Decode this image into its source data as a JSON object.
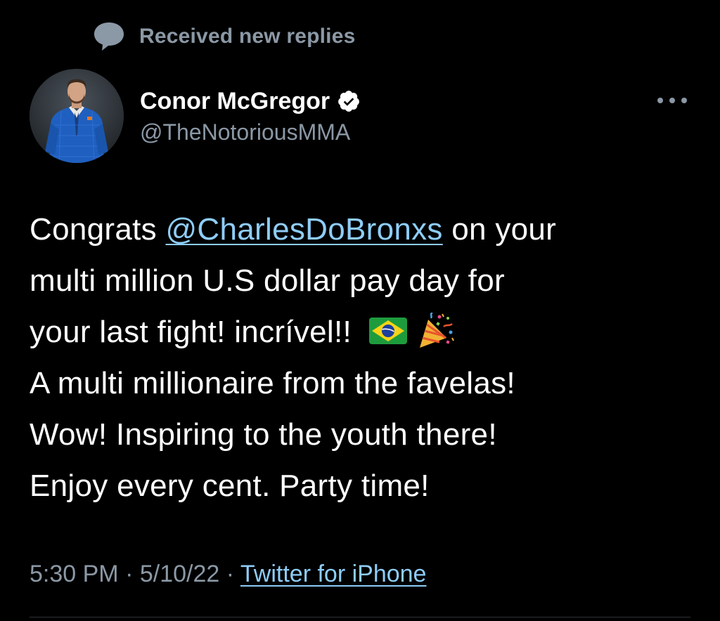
{
  "notice": {
    "text": "Received new replies",
    "icon": "speech-bubble-icon"
  },
  "author": {
    "display_name": "Conor McGregor",
    "handle": "@TheNotoriousMMA",
    "verified_icon": "verified-badge-icon",
    "avatar": "profile-photo"
  },
  "tweet": {
    "line1_prefix": "Congrats ",
    "mention": "@CharlesDoBronxs",
    "line1_suffix": " on your",
    "line2": "multi million U.S dollar pay day for",
    "line3": "your last fight! incrível!! ",
    "emoji_1": "brazil-flag-emoji",
    "emoji_2": "party-popper-emoji",
    "line4": "A multi millionaire from the favelas!",
    "line5": "Wow! Inspiring to the youth there!",
    "line6": "Enjoy every cent. Party time!"
  },
  "meta": {
    "time": "5:30 PM",
    "sep1": " · ",
    "date": "5/10/22",
    "sep2": " · ",
    "source": "Twitter for iPhone"
  },
  "colors": {
    "background": "#000000",
    "text": "#ffffff",
    "secondary_text": "#8b98a5",
    "link": "#8ecdf8"
  }
}
